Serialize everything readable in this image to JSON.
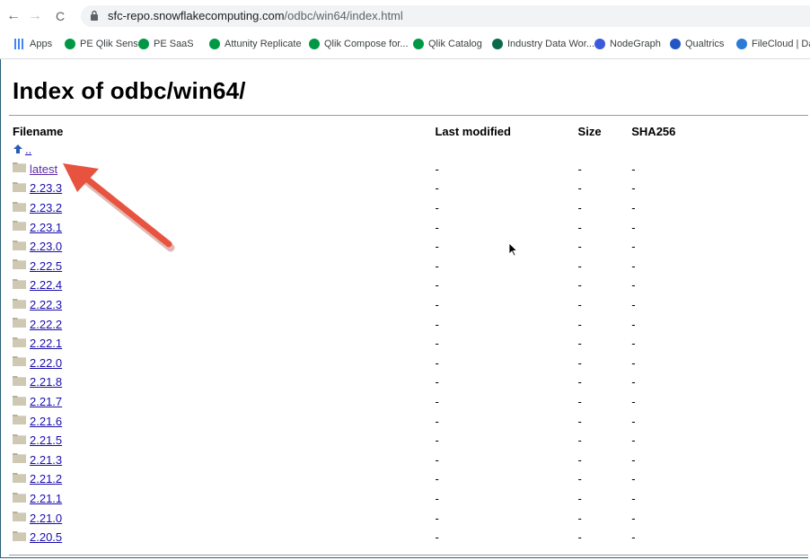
{
  "browser": {
    "back_icon": "←",
    "forward_icon": "→",
    "reload_icon": "C",
    "url_host": "sfc-repo.snowflakecomputing.com",
    "url_path": "/odbc/win64/index.html"
  },
  "bookmarks": [
    {
      "label": "Apps",
      "color": "#4285f4"
    },
    {
      "label": "PE Qlik Sense",
      "color": "#009845"
    },
    {
      "label": "PE SaaS",
      "color": "#009845"
    },
    {
      "label": "Attunity Replicate",
      "color": "#009845"
    },
    {
      "label": "Qlik Compose for...",
      "color": "#009845"
    },
    {
      "label": "Qlik Catalog",
      "color": "#009845"
    },
    {
      "label": "Industry Data Wor...",
      "color": "#0a6b4a"
    },
    {
      "label": "NodeGraph",
      "color": "#3b5bdb"
    },
    {
      "label": "Qualtrics",
      "color": "#2455c6"
    },
    {
      "label": "FileCloud | Dav",
      "color": "#2b7bd6"
    }
  ],
  "page": {
    "title": "Index of odbc/win64/",
    "columns": {
      "filename": "Filename",
      "last_modified": "Last modified",
      "size": "Size",
      "sha256": "SHA256"
    },
    "parent_link": "..",
    "rows": [
      {
        "name": "latest",
        "modified": "-",
        "size": "-",
        "sha": "-"
      },
      {
        "name": "2.23.3",
        "modified": "-",
        "size": "-",
        "sha": "-"
      },
      {
        "name": "2.23.2",
        "modified": "-",
        "size": "-",
        "sha": "-"
      },
      {
        "name": "2.23.1",
        "modified": "-",
        "size": "-",
        "sha": "-"
      },
      {
        "name": "2.23.0",
        "modified": "-",
        "size": "-",
        "sha": "-"
      },
      {
        "name": "2.22.5",
        "modified": "-",
        "size": "-",
        "sha": "-"
      },
      {
        "name": "2.22.4",
        "modified": "-",
        "size": "-",
        "sha": "-"
      },
      {
        "name": "2.22.3",
        "modified": "-",
        "size": "-",
        "sha": "-"
      },
      {
        "name": "2.22.2",
        "modified": "-",
        "size": "-",
        "sha": "-"
      },
      {
        "name": "2.22.1",
        "modified": "-",
        "size": "-",
        "sha": "-"
      },
      {
        "name": "2.22.0",
        "modified": "-",
        "size": "-",
        "sha": "-"
      },
      {
        "name": "2.21.8",
        "modified": "-",
        "size": "-",
        "sha": "-"
      },
      {
        "name": "2.21.7",
        "modified": "-",
        "size": "-",
        "sha": "-"
      },
      {
        "name": "2.21.6",
        "modified": "-",
        "size": "-",
        "sha": "-"
      },
      {
        "name": "2.21.5",
        "modified": "-",
        "size": "-",
        "sha": "-"
      },
      {
        "name": "2.21.3",
        "modified": "-",
        "size": "-",
        "sha": "-"
      },
      {
        "name": "2.21.2",
        "modified": "-",
        "size": "-",
        "sha": "-"
      },
      {
        "name": "2.21.1",
        "modified": "-",
        "size": "-",
        "sha": "-"
      },
      {
        "name": "2.21.0",
        "modified": "-",
        "size": "-",
        "sha": "-"
      },
      {
        "name": "2.20.5",
        "modified": "-",
        "size": "-",
        "sha": "-"
      }
    ]
  },
  "annotation": {
    "arrow_color": "#e8533f"
  }
}
